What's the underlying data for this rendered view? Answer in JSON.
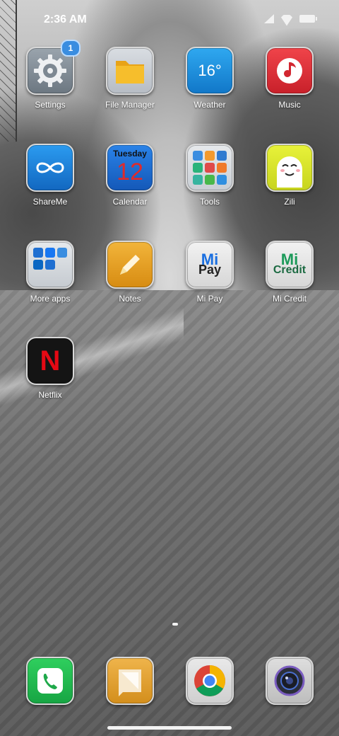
{
  "status_bar": {
    "time": "2:36 AM"
  },
  "apps": {
    "settings": {
      "label": "Settings",
      "badge": "1"
    },
    "file_manager": {
      "label": "File Manager"
    },
    "weather": {
      "label": "Weather",
      "temp": "16°"
    },
    "music": {
      "label": "Music"
    },
    "shareme": {
      "label": "ShareMe"
    },
    "calendar": {
      "label": "Calendar",
      "day": "Tuesday",
      "date": "12"
    },
    "tools": {
      "label": "Tools"
    },
    "zili": {
      "label": "Zili"
    },
    "more_apps": {
      "label": "More apps"
    },
    "notes": {
      "label": "Notes"
    },
    "mi_pay": {
      "label": "Mi Pay",
      "logo_mark": "Mi",
      "logo_word": "Pay"
    },
    "mi_credit": {
      "label": "Mi Credit",
      "logo_mark": "Mi",
      "logo_word": "Credit"
    },
    "netflix": {
      "label": "Netflix",
      "logo": "N"
    }
  },
  "dock": [
    "phone",
    "messaging",
    "chrome",
    "camera"
  ],
  "colors": {
    "badge": "#3a8de0",
    "netflix_red": "#e50914",
    "calendar_red": "#e02a2a"
  }
}
